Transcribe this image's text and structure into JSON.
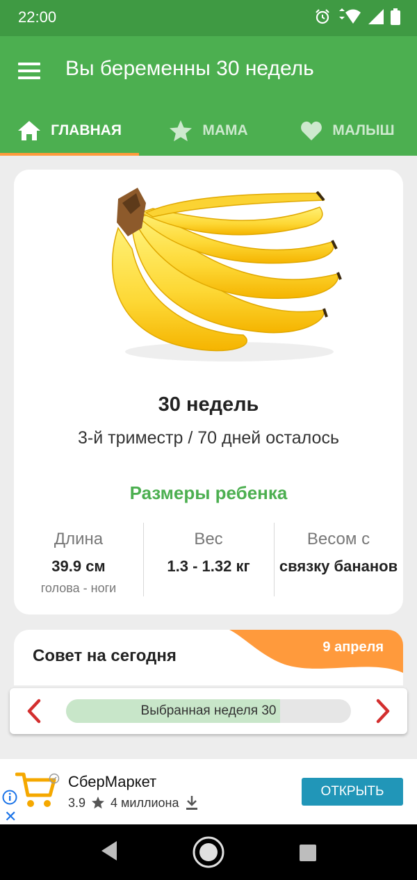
{
  "status_bar": {
    "time": "22:00"
  },
  "app_bar": {
    "title": "Вы беременны 30 недель"
  },
  "tabs": [
    {
      "label": "ГЛАВНАЯ",
      "icon": "home-icon",
      "active": true
    },
    {
      "label": "МАМА",
      "icon": "star-icon",
      "active": false
    },
    {
      "label": "МАЛЫШ",
      "icon": "heart-icon",
      "active": false
    }
  ],
  "week_card": {
    "image": "banana-bunch",
    "week_title": "30 недель",
    "subtitle": "3-й триместр / 70 дней осталось",
    "sizes_title": "Размеры ребенка",
    "stats": [
      {
        "label": "Длина",
        "value": "39.9 см",
        "note": "голова - ноги"
      },
      {
        "label": "Вес",
        "value": "1.3 - 1.32 кг",
        "note": ""
      },
      {
        "label": "Весом с",
        "value": "связку бананов",
        "note": ""
      }
    ]
  },
  "tip_card": {
    "title": "Совет на сегодня",
    "date": "9 апреля"
  },
  "week_nav": {
    "label": "Выбранная неделя 30",
    "progress": 0.75
  },
  "ad": {
    "name": "СберМаркет",
    "rating": "3.9",
    "downloads": "4 миллиона",
    "button": "ОТКРЫТЬ"
  },
  "colors": {
    "primary": "#4caf50",
    "status_bar": "#3f9a43",
    "accent": "#ff9a3c",
    "arrow": "#d32f2f",
    "ad_button": "#2196b8"
  }
}
